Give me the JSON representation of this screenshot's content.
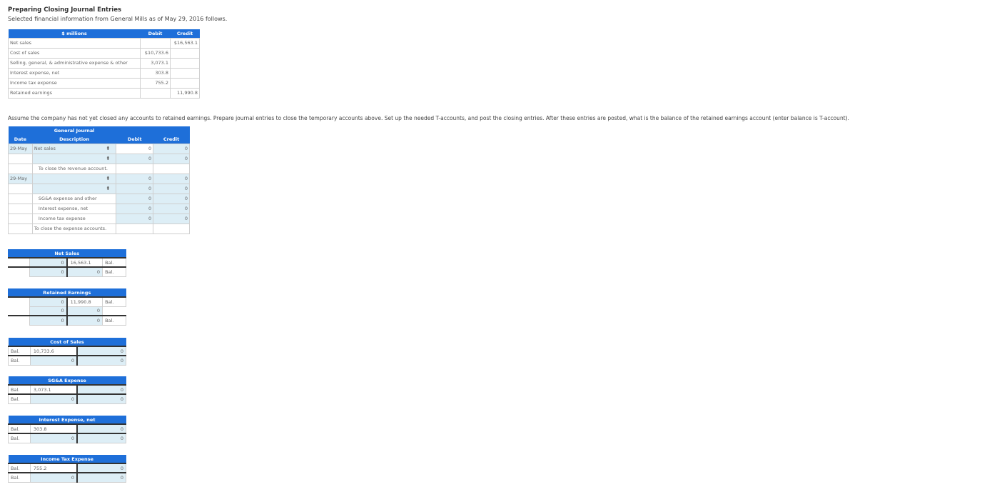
{
  "page": {
    "title": "Preparing Closing Journal Entries",
    "subtitle": "Selected financial information from General Mills as of May 29, 2016 follows.",
    "question": "Assume the company has not yet closed any accounts to retained earnings. Prepare journal entries to close the temporary accounts above. Set up the needed T-accounts, and post the closing entries. After these entries are posted, what is the balance of the retained earnings account (enter balance is T-account)."
  },
  "info_table": {
    "headers": [
      "$ millions",
      "Debit",
      "Credit"
    ],
    "rows": [
      {
        "label": "Net sales",
        "debit": "",
        "credit": "$16,563.1"
      },
      {
        "label": "Cost of sales",
        "debit": "$10,733.6",
        "credit": ""
      },
      {
        "label": "Selling, general, & administrative expense & other",
        "debit": "3,073.1",
        "credit": ""
      },
      {
        "label": "Interest expense, net",
        "debit": "303.8",
        "credit": ""
      },
      {
        "label": "Income tax expense",
        "debit": "755.2",
        "credit": ""
      },
      {
        "label": "Retained earnings",
        "debit": "",
        "credit": "11,990.8"
      }
    ]
  },
  "journal": {
    "title": "General Journal",
    "headers": [
      "Date",
      "Description",
      "Debit",
      "Credit"
    ],
    "e1": {
      "date": "29-May",
      "row1": {
        "desc": "Net sales",
        "debit": "0",
        "credit": "0"
      },
      "row2": {
        "desc": "",
        "debit": "0",
        "credit": "0"
      },
      "memo": "To close the revenue account."
    },
    "e2": {
      "date": "29-May",
      "row1": {
        "desc": "",
        "debit": "0",
        "credit": "0"
      },
      "row2": {
        "desc": "",
        "debit": "0",
        "credit": "0"
      },
      "row3": {
        "desc": "SG&A expense and other",
        "debit": "0",
        "credit": "0"
      },
      "row4": {
        "desc": "Interest expense, net",
        "debit": "0",
        "credit": "0"
      },
      "row5": {
        "desc": "Income tax expense",
        "debit": "0",
        "credit": "0"
      },
      "memo": "To close the expense accounts."
    }
  },
  "t_accounts": {
    "net_sales": {
      "title": "Net Sales",
      "r1": {
        "debit": "0",
        "credit": "16,563.1",
        "right_label": "Bal."
      },
      "r2": {
        "debit": "0",
        "credit": "0",
        "right_label": "Bal."
      }
    },
    "retained_earnings": {
      "title": "Retained Earnings",
      "r1": {
        "debit": "0",
        "credit": "11,990.8",
        "right_label": "Bal."
      },
      "r2": {
        "debit": "0",
        "credit": "0"
      },
      "r3": {
        "debit": "0",
        "credit": "0",
        "right_label": "Bal."
      }
    },
    "cost_of_sales": {
      "title": "Cost of Sales",
      "r1": {
        "left_label": "Bal.",
        "debit": "10,733.6",
        "credit": "0"
      },
      "r2": {
        "left_label": "Bal.",
        "debit": "0",
        "credit": "0"
      }
    },
    "sga": {
      "title": "SG&A Expense",
      "r1": {
        "left_label": "Bal.",
        "debit": "3,073.1",
        "credit": "0"
      },
      "r2": {
        "left_label": "Bal.",
        "debit": "0",
        "credit": "0"
      }
    },
    "interest": {
      "title": "Interest Expense, net",
      "r1": {
        "left_label": "Bal.",
        "debit": "303.8",
        "credit": "0"
      },
      "r2": {
        "left_label": "Bal.",
        "debit": "0",
        "credit": "0"
      }
    },
    "income_tax": {
      "title": "Income Tax Expense",
      "r1": {
        "left_label": "Bal.",
        "debit": "755.2",
        "credit": "0"
      },
      "r2": {
        "left_label": "Bal.",
        "debit": "0",
        "credit": "0"
      }
    }
  }
}
